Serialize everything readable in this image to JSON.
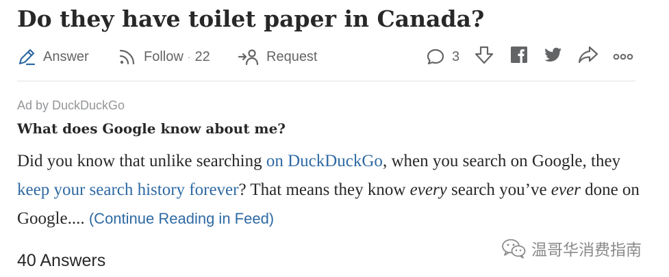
{
  "question": {
    "title": "Do they have toilet paper in Canada?"
  },
  "actions": {
    "answer_label": "Answer",
    "follow_label": "Follow",
    "follow_sep": "·",
    "follow_count": "22",
    "request_label": "Request",
    "comments_count": "3",
    "icons": [
      "pencil-icon",
      "follow-signal-icon",
      "request-icon",
      "comment-icon",
      "downvote-icon",
      "facebook-icon",
      "twitter-icon",
      "share-icon",
      "more-icon"
    ]
  },
  "ad": {
    "label": "Ad by DuckDuckGo",
    "title": "What does Google know about me?",
    "body": {
      "t1": "Did you know that unlike searching ",
      "link1": "on DuckDuckGo",
      "t2": ", when you search on Google, they ",
      "link2": "keep your search history forever",
      "t3": "? That means they know ",
      "em1": "every",
      "t4": " search you’ve ",
      "em2": "ever",
      "t5": " done on Google.... ",
      "continue": "(Continue Reading in Feed)"
    }
  },
  "answers": {
    "count_label": "40 Answers"
  },
  "watermark": {
    "text": "温哥华消费指南"
  },
  "colors": {
    "text": "#282829",
    "muted": "#636466",
    "link": "#2e69a3",
    "pencil_accent": "#2e69a3",
    "divider": "#dee0e1"
  }
}
